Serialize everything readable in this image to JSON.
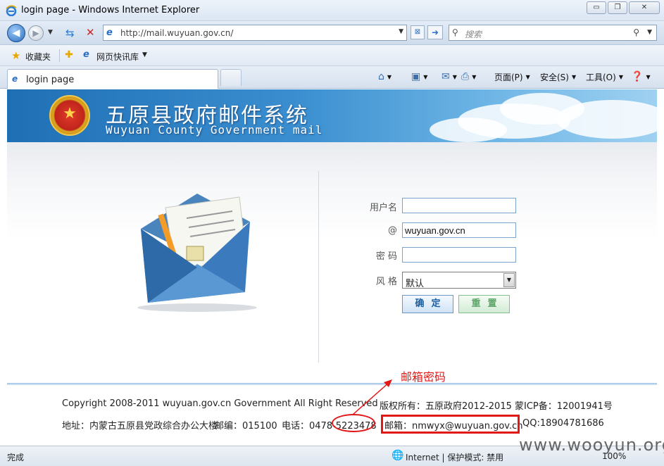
{
  "window": {
    "title": "login page - Windows Internet Explorer",
    "buttons": {
      "minimize": "▭",
      "restore": "❐",
      "close": "✕"
    }
  },
  "nav": {
    "url": "http://mail.wuyuan.gov.cn/",
    "search_placeholder": "搜索"
  },
  "favorites": {
    "label": "收藏夹",
    "web_slice_label": "网页快讯库"
  },
  "tab": {
    "label": "login page"
  },
  "commands": {
    "page": "页面(P)",
    "safety": "安全(S)",
    "tools": "工具(O)"
  },
  "banner": {
    "title_cn": "五原县政府邮件系统",
    "title_en": "Wuyuan County Government mail"
  },
  "form": {
    "username_label": "用户名",
    "username_value": "",
    "at_label": "@",
    "domain_value": "wuyuan.gov.cn",
    "password_label": "密 码",
    "password_value": "",
    "style_label": "风 格",
    "style_value": "默认",
    "ok_label": "确定",
    "reset_label": "重置"
  },
  "footer": {
    "copyright": "Copyright 2008-2011 wuyuan.gov.cn Government All Right Reserved",
    "owner": "版权所有：五原政府2012-2015 蒙ICP备：12001941号",
    "address": "地址：内蒙古五原县党政综合办公大楼",
    "postcode": "邮编：015100",
    "phone": "电话：0478-5223478",
    "email": "邮箱：nmwyx@wuyuan.gov.cn",
    "qq": "QQ:18904781686"
  },
  "annotation": {
    "text": "邮箱密码",
    "color": "#e01818"
  },
  "status": {
    "done": "完成",
    "zone": "Internet | 保护模式: 禁用",
    "zoom": "100%"
  },
  "watermark": "www.wooyun.org",
  "colors": {
    "banner_blue": "#1f6fb5",
    "annotation_red": "#e01818",
    "ok_button_text": "#1c5fa3",
    "reset_button_text": "#5ea66a"
  }
}
